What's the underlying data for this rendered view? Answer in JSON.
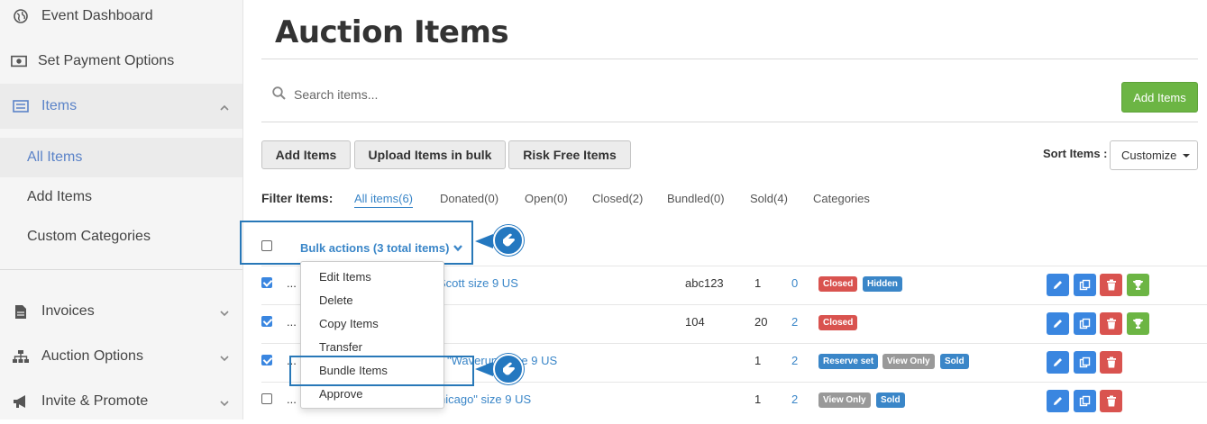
{
  "sidebar": {
    "items": [
      {
        "label": "Event Dashboard"
      },
      {
        "label": "Set Payment Options"
      },
      {
        "label": "Items"
      },
      {
        "label": "Invoices"
      },
      {
        "label": "Auction Options"
      },
      {
        "label": "Invite & Promote"
      }
    ],
    "sub_items": [
      {
        "label": "All Items"
      },
      {
        "label": "Add Items"
      },
      {
        "label": "Custom Categories"
      }
    ]
  },
  "page": {
    "title": "Auction Items",
    "search_placeholder": "Search items...",
    "add_items_green": "Add Items"
  },
  "toolbar": {
    "add_items": "Add Items",
    "upload_bulk": "Upload Items in bulk",
    "risk_free": "Risk Free Items",
    "sort_label": "Sort Items :",
    "sort_value": "Customize"
  },
  "filters": {
    "label": "Filter Items:",
    "items": [
      "All items(6)",
      "Donated(0)",
      "Open(0)",
      "Closed(2)",
      "Bundled(0)",
      "Sold(4)",
      "Categories"
    ]
  },
  "bulk": {
    "label": "Bulk actions (3 total items)"
  },
  "dropdown": {
    "items": [
      "Edit Items",
      "Delete",
      "Copy Items",
      "Transfer",
      "Bundle Items",
      "Approve"
    ]
  },
  "rows": [
    {
      "prefix": "...",
      "name": "Scott size 9 US",
      "code": "abc123",
      "qty": "1",
      "bids": "0",
      "badges": [
        "Closed",
        "Hidden"
      ],
      "checked": true
    },
    {
      "prefix": "...",
      "name": "",
      "code": "104",
      "qty": "20",
      "bids": "2",
      "badges": [
        "Closed"
      ],
      "checked": true
    },
    {
      "prefix": "...",
      "name": "\"Waverun\" Size 9 US",
      "code": "",
      "qty": "1",
      "bids": "2",
      "badges": [
        "Reserve set",
        "View Only",
        "Sold"
      ],
      "checked": true
    },
    {
      "prefix": "...",
      "name": "hicago\" size 9 US",
      "code": "",
      "qty": "1",
      "bids": "2",
      "badges": [
        "View Only",
        "Sold"
      ],
      "checked": false
    }
  ],
  "colors": {
    "accent": "#3a86c8",
    "green": "#6cb544",
    "red": "#d9534f",
    "highlight": "#2878b8"
  }
}
